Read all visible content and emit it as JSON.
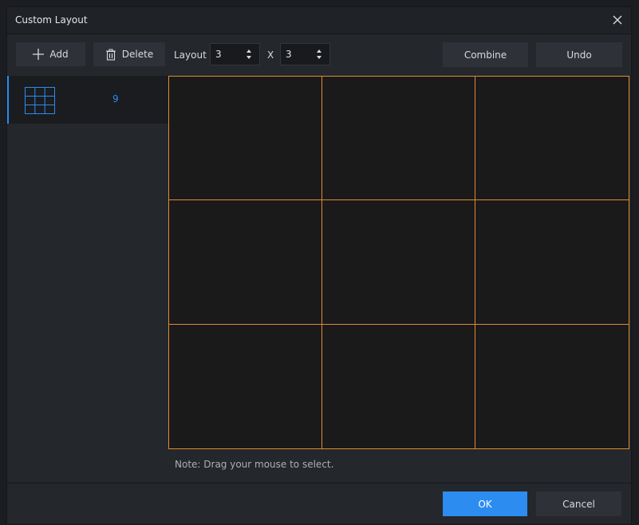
{
  "dialog": {
    "title": "Custom Layout"
  },
  "toolbar": {
    "add_label": "Add",
    "delete_label": "Delete",
    "layout_label": "Layout",
    "rows_value": "3",
    "x_label": "X",
    "cols_value": "3",
    "combine_label": "Combine",
    "undo_label": "Undo"
  },
  "sidebar": {
    "items": [
      {
        "icon": "grid-3x3-icon",
        "count": "9"
      }
    ]
  },
  "grid": {
    "rows": 3,
    "cols": 3,
    "cell_border_color": "#e08a32"
  },
  "note": "Note: Drag your mouse to select.",
  "footer": {
    "ok_label": "OK",
    "cancel_label": "Cancel"
  },
  "colors": {
    "accent": "#2c8cf0",
    "grid_line": "#e08a32",
    "background": "#24272b"
  }
}
